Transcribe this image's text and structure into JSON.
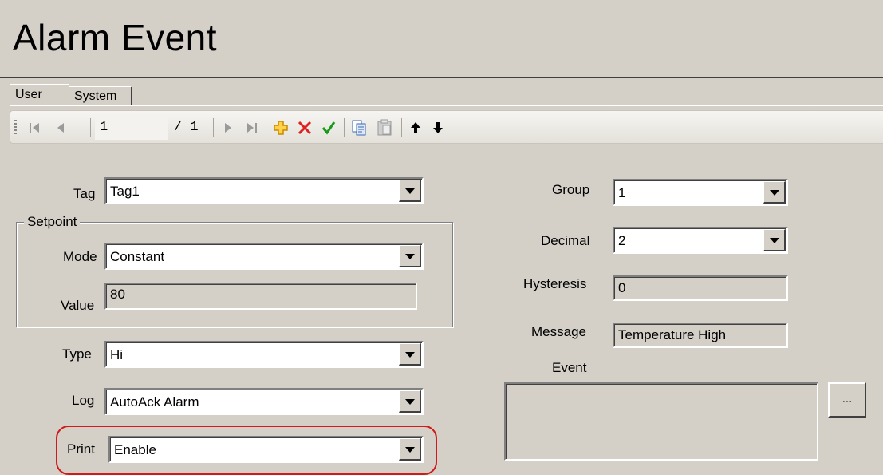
{
  "title": "Alarm  Event",
  "tabs": [
    {
      "label": "User",
      "active": true
    },
    {
      "label": "System",
      "active": false
    }
  ],
  "toolbar": {
    "icons": [
      "first-record-icon",
      "prev-record-icon",
      "next-record-icon",
      "last-record-icon",
      "add-icon",
      "delete-icon",
      "accept-icon",
      "copy-icon",
      "paste-icon",
      "move-up-icon",
      "move-down-icon"
    ],
    "record_current": "1",
    "record_total": "/ 1",
    "colors": {
      "add": "#f0a800",
      "delete": "#e02020",
      "accept": "#1a9a1a"
    }
  },
  "form": {
    "tag": {
      "label": "Tag",
      "value": "Tag1"
    },
    "setpoint": {
      "title": "Setpoint",
      "mode": {
        "label": "Mode",
        "value": "Constant"
      },
      "value": {
        "label": "Value",
        "value": "80"
      }
    },
    "type": {
      "label": "Type",
      "value": "Hi"
    },
    "log": {
      "label": "Log",
      "value": "AutoAck Alarm"
    },
    "print": {
      "label": "Print",
      "value": "Enable"
    },
    "group": {
      "label": "Group",
      "value": "1"
    },
    "decimal": {
      "label": "Decimal",
      "value": "2"
    },
    "hysteresis": {
      "label": "Hysteresis",
      "value": "0"
    },
    "message": {
      "label": "Message",
      "value": "Temperature High"
    },
    "event": {
      "label": "Event",
      "value": "",
      "browse_label": "..."
    }
  },
  "highlight_color": "#d11a1a"
}
